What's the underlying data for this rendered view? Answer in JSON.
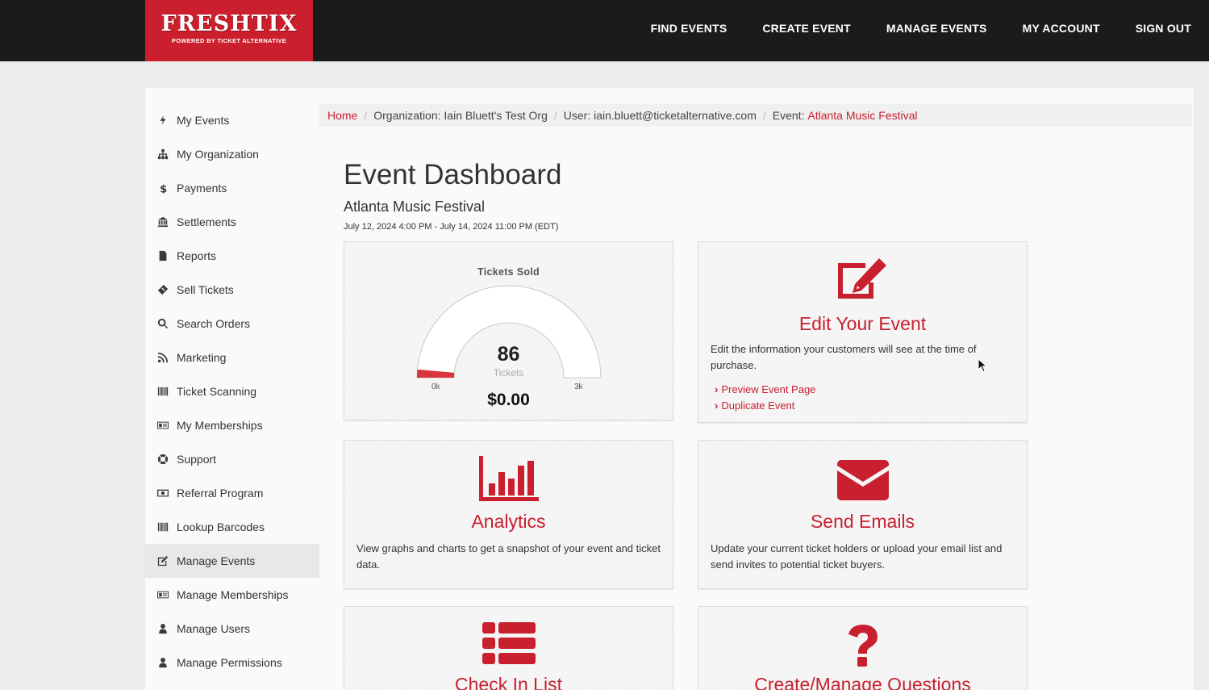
{
  "header": {
    "logo_main": "FRESHTIX",
    "logo_sub": "POWERED BY TICKET ALTERNATIVE",
    "nav": [
      "FIND EVENTS",
      "CREATE EVENT",
      "MANAGE EVENTS",
      "MY ACCOUNT",
      "SIGN OUT"
    ]
  },
  "sidebar": {
    "items": [
      {
        "label": "My Events",
        "icon": "bolt-icon"
      },
      {
        "label": "My Organization",
        "icon": "sitemap-icon"
      },
      {
        "label": "Payments",
        "icon": "dollar-icon"
      },
      {
        "label": "Settlements",
        "icon": "bank-icon"
      },
      {
        "label": "Reports",
        "icon": "file-icon"
      },
      {
        "label": "Sell Tickets",
        "icon": "ticket-icon"
      },
      {
        "label": "Search Orders",
        "icon": "search-icon"
      },
      {
        "label": "Marketing",
        "icon": "rss-icon"
      },
      {
        "label": "Ticket Scanning",
        "icon": "barcode-icon"
      },
      {
        "label": "My Memberships",
        "icon": "id-card-icon"
      },
      {
        "label": "Support",
        "icon": "life-ring-icon"
      },
      {
        "label": "Referral Program",
        "icon": "money-icon"
      },
      {
        "label": "Lookup Barcodes",
        "icon": "barcode-icon"
      },
      {
        "label": "Manage Events",
        "icon": "edit-icon",
        "active": true
      },
      {
        "label": "Manage Memberships",
        "icon": "id-card-icon"
      },
      {
        "label": "Manage Users",
        "icon": "user-icon"
      },
      {
        "label": "Manage Permissions",
        "icon": "user-icon"
      }
    ]
  },
  "breadcrumb": {
    "home": "Home",
    "organization": "Organization: Iain Bluett's Test Org",
    "user": "User: iain.bluett@ticketalternative.com",
    "event_prefix": "Event: ",
    "event_link": "Atlanta Music Festival"
  },
  "page": {
    "title": "Event Dashboard",
    "event_name": "Atlanta Music Festival",
    "event_date": "July 12, 2024 4:00 PM - July 14, 2024 11:00 PM (EDT)"
  },
  "tickets_card": {
    "label": "Tickets Sold",
    "value": "86",
    "unit": "Tickets",
    "min_label": "0k",
    "max_label": "3k",
    "gauge_max": 3000,
    "gauge_value": 86,
    "amount": "$0.00"
  },
  "cards": {
    "edit": {
      "title": "Edit Your Event",
      "desc": "Edit the information your customers will see at the time of purchase.",
      "links": [
        "Preview Event Page",
        "Duplicate Event"
      ]
    },
    "analytics": {
      "title": "Analytics",
      "desc": "View graphs and charts to get a snapshot of your event and ticket data."
    },
    "emails": {
      "title": "Send Emails",
      "desc": "Update your current ticket holders or upload your email list and send invites to potential ticket buyers."
    },
    "checkin": {
      "title": "Check In List"
    },
    "questions": {
      "title": "Create/Manage Questions"
    }
  },
  "colors": {
    "brand_red": "#c8202f",
    "header_bg": "#1b1b1b",
    "logo_bg": "#cc1f2d"
  }
}
